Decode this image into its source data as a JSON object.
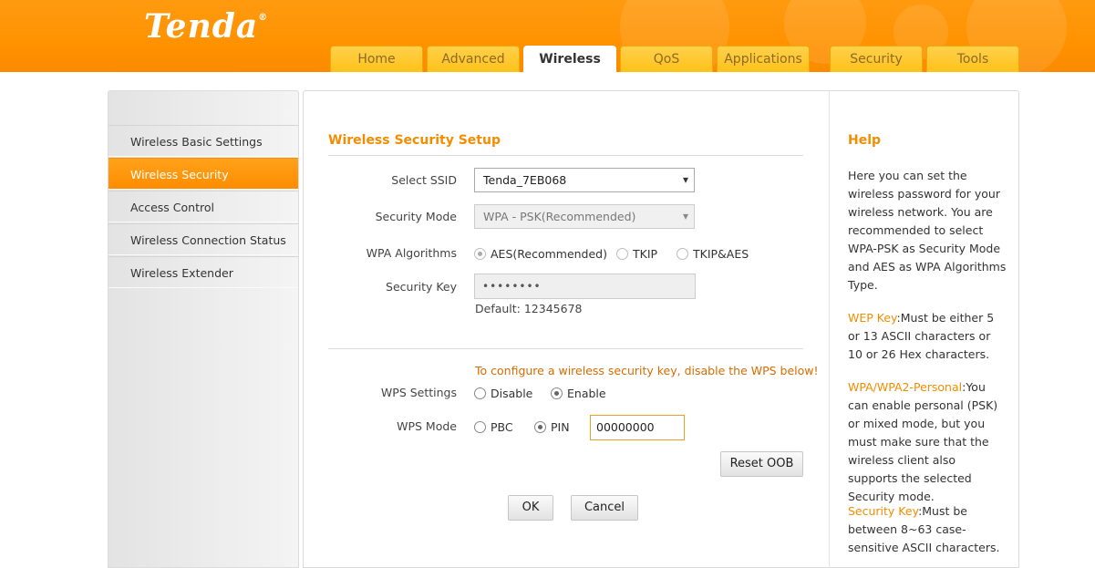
{
  "brand": {
    "logo": "Tenda",
    "mark": "®"
  },
  "nav": {
    "tabs": [
      "Home",
      "Advanced",
      "Wireless",
      "QoS",
      "Applications",
      "Security",
      "Tools"
    ],
    "active": "Wireless"
  },
  "sidebar": {
    "items": [
      "Wireless Basic Settings",
      "Wireless Security",
      "Access Control",
      "Wireless Connection Status",
      "Wireless Extender"
    ],
    "active": "Wireless Security"
  },
  "form": {
    "title": "Wireless Security Setup",
    "ssid": {
      "label": "Select SSID",
      "value": "Tenda_7EB068"
    },
    "security_mode": {
      "label": "Security Mode",
      "value": "WPA - PSK(Recommended)"
    },
    "wpa_algorithms": {
      "label": "WPA Algorithms",
      "options": [
        "AES(Recommended)",
        "TKIP",
        "TKIP&AES"
      ],
      "selected": "AES(Recommended)"
    },
    "security_key": {
      "label": "Security Key",
      "value": "••••••••",
      "default_note": "Default: 12345678"
    },
    "wps_notice": "To configure a wireless security key, disable the WPS below!",
    "wps_settings": {
      "label": "WPS Settings",
      "options": [
        "Disable",
        "Enable"
      ],
      "selected": "Enable"
    },
    "wps_mode": {
      "label": "WPS Mode",
      "options": [
        "PBC",
        "PIN"
      ],
      "selected": "PIN",
      "pin_value": "00000000"
    },
    "reset_oob": "Reset OOB",
    "ok": "OK",
    "cancel": "Cancel"
  },
  "help": {
    "title": "Help",
    "intro": "Here you can set the wireless password for your wireless network. You are recommended to select WPA-PSK as Security Mode and AES as WPA Algorithms Type.",
    "wep_term": "WEP Key",
    "wep_text": ":Must be either 5 or 13 ASCII characters or 10 or 26 Hex characters.",
    "wpa_term": "WPA/WPA2-Personal",
    "wpa_text": ":You can enable personal (PSK) or mixed mode, but you must make sure that the wireless client also supports the selected Security mode.",
    "key_term": "Security Key",
    "key_text": ":Must be between 8~63 case-sensitive ASCII characters."
  },
  "colors": {
    "accent": "#ff9200",
    "highlight": "#f28c00",
    "notice": "#d96b00"
  }
}
